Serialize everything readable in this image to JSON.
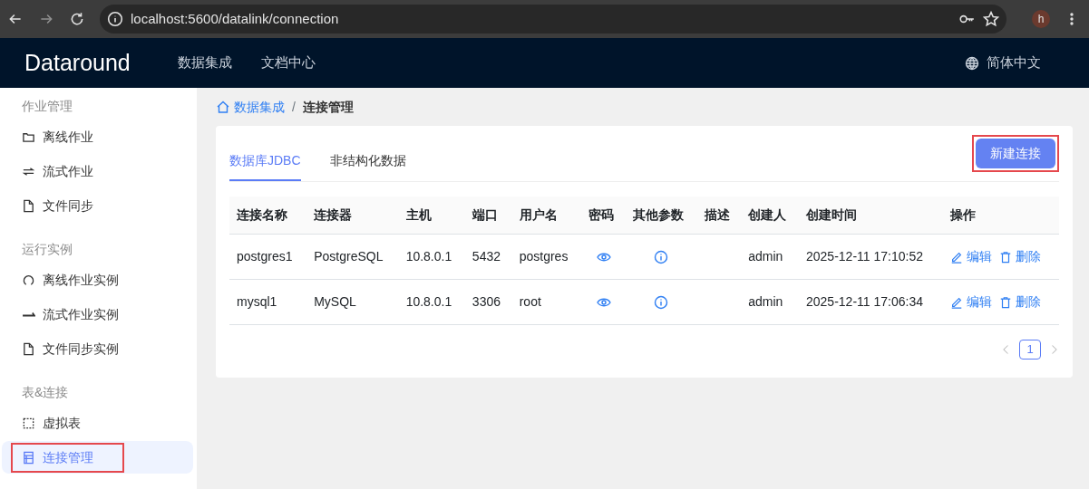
{
  "browser": {
    "url": "localhost:5600/datalink/connection",
    "profile": "h"
  },
  "header": {
    "logo": "Dataround",
    "nav": [
      {
        "label": "数据集成"
      },
      {
        "label": "文档中心"
      }
    ],
    "language": "简体中文"
  },
  "sidebar": {
    "groups": [
      {
        "title": "作业管理",
        "items": [
          {
            "label": "离线作业",
            "selected": false,
            "annotated": false
          },
          {
            "label": "流式作业",
            "selected": false,
            "annotated": false
          },
          {
            "label": "文件同步",
            "selected": false,
            "annotated": false
          }
        ]
      },
      {
        "title": "运行实例",
        "items": [
          {
            "label": "离线作业实例",
            "selected": false,
            "annotated": false
          },
          {
            "label": "流式作业实例",
            "selected": false,
            "annotated": false
          },
          {
            "label": "文件同步实例",
            "selected": false,
            "annotated": false
          }
        ]
      },
      {
        "title": "表&连接",
        "items": [
          {
            "label": "虚拟表",
            "selected": false,
            "annotated": false
          },
          {
            "label": "连接管理",
            "selected": true,
            "annotated": true
          }
        ]
      }
    ]
  },
  "breadcrumb": {
    "items": [
      "数据集成",
      "连接管理"
    ],
    "separator": "/"
  },
  "tabs": [
    {
      "label": "数据库JDBC",
      "selected": true
    },
    {
      "label": "非结构化数据",
      "selected": false
    }
  ],
  "new_button": {
    "label": "新建连接",
    "annotated": true
  },
  "table": {
    "columns": [
      "连接名称",
      "连接器",
      "主机",
      "端口",
      "用户名",
      "密码",
      "其他参数",
      "描述",
      "创建人",
      "创建时间",
      "操作"
    ],
    "rows": [
      {
        "cells": [
          "postgres1",
          "PostgreSQL",
          "10.8.0.1",
          "5432",
          "postgres",
          "",
          "",
          "",
          "admin",
          "2025-12-11 17:10:52"
        ],
        "actions": [
          "编辑",
          "删除"
        ]
      },
      {
        "cells": [
          "mysql1",
          "MySQL",
          "10.8.0.1",
          "3306",
          "root",
          "",
          "",
          "",
          "admin",
          "2025-12-11 17:06:34"
        ],
        "actions": [
          "编辑",
          "删除"
        ]
      }
    ]
  },
  "pagination": {
    "pages": [
      {
        "label": "1",
        "selected": true
      }
    ]
  }
}
